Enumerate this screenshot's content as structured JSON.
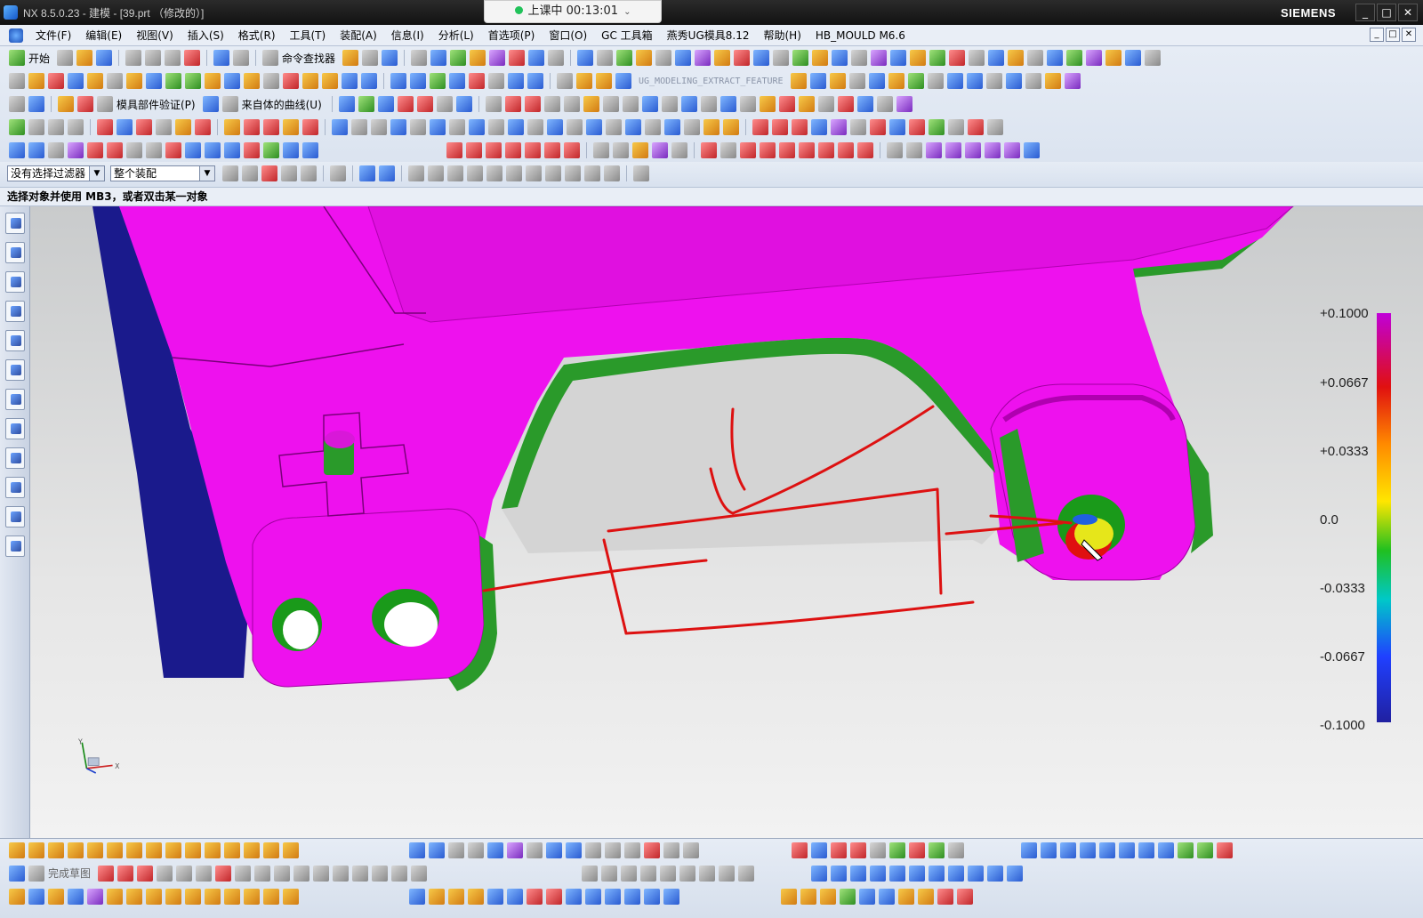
{
  "window": {
    "title": "NX 8.5.0.23 - 建模 - [39.prt （修改的）]",
    "brand": "SIEMENS",
    "minimize": "_",
    "maximize": "□",
    "close": "✕"
  },
  "recording": {
    "label": "上课中 00:13:01",
    "status_color": "#21c25a"
  },
  "menu": {
    "items": [
      "文件(F)",
      "编辑(E)",
      "视图(V)",
      "插入(S)",
      "格式(R)",
      "工具(T)",
      "装配(A)",
      "信息(I)",
      "分析(L)",
      "首选项(P)",
      "窗口(O)",
      "GC 工具箱",
      "燕秀UG模具8.12",
      "帮助(H)",
      "HB_MOULD M6.6"
    ]
  },
  "toolbar": {
    "start_label": "开始",
    "command_finder": "命令查找器",
    "mold_part_validation": "模具部件验证(P)",
    "curve_from_body": "来自体的曲线(U)",
    "extract_feature": "UG_MODELING_EXTRACT_FEATURE",
    "finish_sketch": "完成草图"
  },
  "selection": {
    "filter_value": "没有选择过滤器",
    "scope_value": "整个装配"
  },
  "cue_line": "选择对象并使用 MB3，或者双击某一对象",
  "legend": {
    "values": [
      "+0.1000",
      "+0.0667",
      "+0.0333",
      "0.0",
      "-0.0333",
      "-0.0667",
      "-0.1000"
    ]
  },
  "triad": {
    "x_label": "X",
    "y_label": "Y"
  },
  "colors": {
    "part_face": "#ee11ee",
    "part_side": "#2a9a2a",
    "part_back": "#1a1a8c",
    "annotation": "#dd1111",
    "toolbar_bg": "#dde5f0"
  }
}
